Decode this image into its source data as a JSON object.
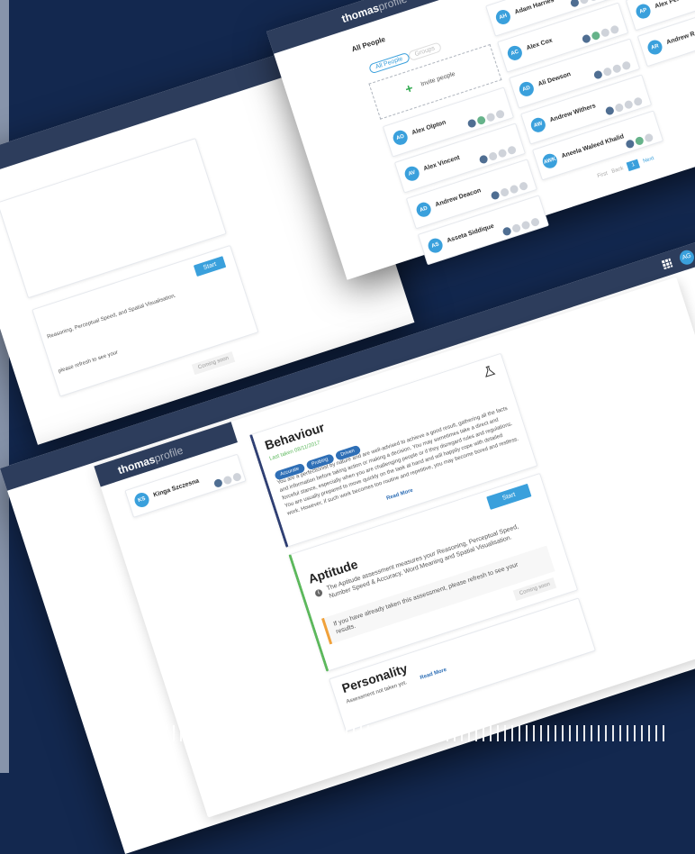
{
  "brand": {
    "logo_bold": "thomas",
    "logo_light": "profile",
    "user_initials": "AG"
  },
  "people_window": {
    "title": "All People",
    "filters": [
      "All People",
      "Groups"
    ],
    "invite_label": "Invite people",
    "people": [
      {
        "initials": "AO",
        "name": "Alex Olpton"
      },
      {
        "initials": "AV",
        "name": "Alex Vincent"
      },
      {
        "initials": "AD",
        "name": "Andrew Deacon"
      },
      {
        "initials": "AS",
        "name": "Asseta Siddique"
      },
      {
        "initials": "AH",
        "name": "Adam Harries"
      },
      {
        "initials": "AC",
        "name": "Alex Cox"
      },
      {
        "initials": "AD",
        "name": "Ali Dewson"
      },
      {
        "initials": "AW",
        "name": "Andrew Withers"
      },
      {
        "initials": "AWK",
        "name": "Aneela Waleed Khalid"
      },
      {
        "initials": "AP",
        "name": "Alex Perez"
      },
      {
        "initials": "AR",
        "name": "Andrew R"
      }
    ],
    "pagination": {
      "prev": "First",
      "back": "Back",
      "current": "1",
      "next": "Next"
    }
  },
  "profile_window": {
    "person": {
      "initials": "KS",
      "name": "Kinga Szczesna"
    },
    "behaviour": {
      "title": "Behaviour",
      "completed": "Last taken 08/11/2017",
      "chips": [
        "Accurate",
        "Probing",
        "Driven"
      ],
      "description": "You are a perfectionist by nature and are well-advised to achieve a good result, gathering all the facts and information before taking action or making a decision. You may sometimes take a direct and forceful stance, especially when you are challenging people or if they disregard rules and regulations. You are usually prepared to move quickly on the task at hand and will happily cope with detailed work. However, if such work becomes too routine and repetitive, you may become bored and restless.",
      "read_more": "Read More"
    },
    "aptitude": {
      "title": "Aptitude",
      "start_label": "Start",
      "description": "The Aptitude assessment measures your Reasoning, Perceptual Speed, Number Speed & Accuracy, Word Meaning and Spatial Visualisation.",
      "notice": "If you have already taken this assessment, please refresh to see your results.",
      "coming_soon": "Coming soon"
    },
    "personality": {
      "title": "Personality",
      "status": "Assessment not taken yet.",
      "link": "Read More"
    }
  },
  "left_window": {
    "start_label": "Start",
    "text_a": "Reasoning, Perceptual Speed, and Spatial Visualisation.",
    "text_b": "please refresh to see your",
    "coming_soon": "Coming soon"
  },
  "colors": {
    "navy_bg": "#13284f",
    "accent_blue": "#3aa0dc",
    "topbar": "#2d3d5c",
    "behaviour_bar": "#2f3f73",
    "aptitude_bar": "#5cb85c",
    "notice_bar": "#f0a13a"
  }
}
